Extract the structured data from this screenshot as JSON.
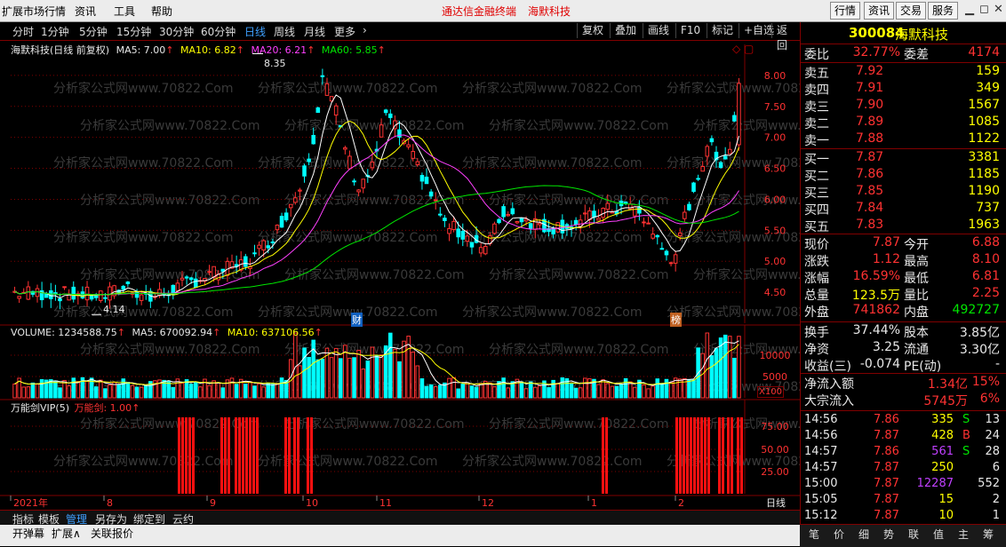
{
  "menubar": {
    "items": [
      "扩展市场行情",
      "资讯",
      "工具",
      "帮助"
    ],
    "title_app": "通达信金融终端",
    "title_stock": "海默科技",
    "right_buttons": [
      "行情",
      "资讯",
      "交易",
      "服务"
    ]
  },
  "toolbar": {
    "periods": [
      "分时",
      "1分钟",
      "5分钟",
      "15分钟",
      "30分钟",
      "60分钟",
      "日线",
      "周线",
      "月线",
      "更多"
    ],
    "active_period": "日线",
    "right_buttons": [
      "复权",
      "叠加",
      "画线",
      "F10",
      "标记",
      "+自选",
      "返回"
    ]
  },
  "main_chart": {
    "legend_name": "海默科技(日线 前复权)",
    "ma5": "MA5: 7.00",
    "ma10": "MA10: 6.82",
    "ma20": "MA20: 6.21",
    "ma60": "MA60: 5.85",
    "high_label": "8.35",
    "low_label": "4.14",
    "marker_cai": "财",
    "marker_bang": "榜",
    "price_axis": [
      "8.00",
      "7.50",
      "7.00",
      "6.50",
      "6.00",
      "5.50",
      "5.00",
      "4.50"
    ],
    "watermark": "分析家公式网www.70822.Com"
  },
  "volume_chart": {
    "volume": "VOLUME: 1234588.75",
    "ma5": "MA5: 670092.94",
    "ma10": "MA10: 637106.56",
    "axis": [
      "10000",
      "5000"
    ],
    "unit": "X100"
  },
  "indicator_chart": {
    "name": "万能剑VIP(5)",
    "value": "万能剑: 1.00",
    "axis": [
      "75.00",
      "50.00",
      "25.00"
    ]
  },
  "date_axis": {
    "labels": [
      "2021年",
      "8",
      "9",
      "10",
      "11",
      "12",
      "1",
      "2"
    ],
    "period_label": "日线"
  },
  "quote": {
    "code": "300084",
    "name": "海默科技",
    "weibi_label": "委比",
    "weibi": "32.77%",
    "weicha_label": "委差",
    "weicha": "4174",
    "asks": [
      {
        "label": "卖五",
        "price": "7.92",
        "vol": "159"
      },
      {
        "label": "卖四",
        "price": "7.91",
        "vol": "349"
      },
      {
        "label": "卖三",
        "price": "7.90",
        "vol": "1567"
      },
      {
        "label": "卖二",
        "price": "7.89",
        "vol": "1085"
      },
      {
        "label": "卖一",
        "price": "7.88",
        "vol": "1122"
      }
    ],
    "bids": [
      {
        "label": "买一",
        "price": "7.87",
        "vol": "3381"
      },
      {
        "label": "买二",
        "price": "7.86",
        "vol": "1185"
      },
      {
        "label": "买三",
        "price": "7.85",
        "vol": "1190"
      },
      {
        "label": "买四",
        "price": "7.84",
        "vol": "737"
      },
      {
        "label": "买五",
        "price": "7.83",
        "vol": "1963"
      }
    ],
    "stats": [
      {
        "l1": "现价",
        "v1": "7.87",
        "c1": "red",
        "l2": "今开",
        "v2": "6.88",
        "c2": "red"
      },
      {
        "l1": "涨跌",
        "v1": "1.12",
        "c1": "red",
        "l2": "最高",
        "v2": "8.10",
        "c2": "red"
      },
      {
        "l1": "涨幅",
        "v1": "16.59%",
        "c1": "red",
        "l2": "最低",
        "v2": "6.81",
        "c2": "red"
      },
      {
        "l1": "总量",
        "v1": "123.5万",
        "c1": "yellow",
        "l2": "量比",
        "v2": "2.25",
        "c2": "red"
      },
      {
        "l1": "外盘",
        "v1": "741862",
        "c1": "red",
        "l2": "内盘",
        "v2": "492727",
        "c2": "green"
      }
    ],
    "stats2": [
      {
        "l1": "换手",
        "v1": "37.44%",
        "l2": "股本",
        "v2": "3.85亿"
      },
      {
        "l1": "净资",
        "v1": "3.25",
        "l2": "流通",
        "v2": "3.30亿"
      },
      {
        "l1": "收益(三)",
        "v1": "-0.074",
        "l2": "PE(动)",
        "v2": "-"
      }
    ],
    "flow": [
      {
        "label": "净流入额",
        "value": "1.34亿",
        "pct": "15%"
      },
      {
        "label": "大宗流入",
        "value": "5745万",
        "pct": "6%"
      }
    ],
    "ticks": [
      {
        "time": "14:56",
        "price": "7.86",
        "vol": "335",
        "vc": "yellow",
        "bs": "S",
        "bsc": "green",
        "n": "13"
      },
      {
        "time": "14:56",
        "price": "7.87",
        "vol": "428",
        "vc": "yellow",
        "bs": "B",
        "bsc": "red",
        "n": "24"
      },
      {
        "time": "14:57",
        "price": "7.86",
        "vol": "561",
        "vc": "purple",
        "bs": "S",
        "bsc": "green",
        "n": "28"
      },
      {
        "time": "14:57",
        "price": "7.87",
        "vol": "250",
        "vc": "yellow",
        "bs": "",
        "bsc": "white",
        "n": "6"
      },
      {
        "time": "15:00",
        "price": "7.87",
        "vol": "12287",
        "vc": "purple",
        "bs": "",
        "bsc": "white",
        "n": "552"
      },
      {
        "time": "15:05",
        "price": "7.87",
        "vol": "15",
        "vc": "yellow",
        "bs": "",
        "bsc": "white",
        "n": "2"
      },
      {
        "time": "15:12",
        "price": "7.87",
        "vol": "10",
        "vc": "yellow",
        "bs": "",
        "bsc": "white",
        "n": "1"
      }
    ],
    "bottom_tabs": [
      "笔",
      "价",
      "细",
      "势",
      "联",
      "值",
      "主",
      "筹"
    ]
  },
  "bottom_tabs": [
    "指标",
    "模板",
    "管理",
    "另存为",
    "绑定到",
    "云约"
  ],
  "bottom_active": "管理",
  "statusbar": [
    "开弹幕",
    "扩展∧",
    "关联报价"
  ],
  "zoom_controls": [
    "+",
    "-",
    "0"
  ],
  "colors": {
    "up": "#ff3232",
    "down": "#00ffff",
    "ma5": "#ffffff",
    "ma10": "#ffff00",
    "ma20": "#ff40ff",
    "ma60": "#00e600",
    "grid": "#800000"
  }
}
